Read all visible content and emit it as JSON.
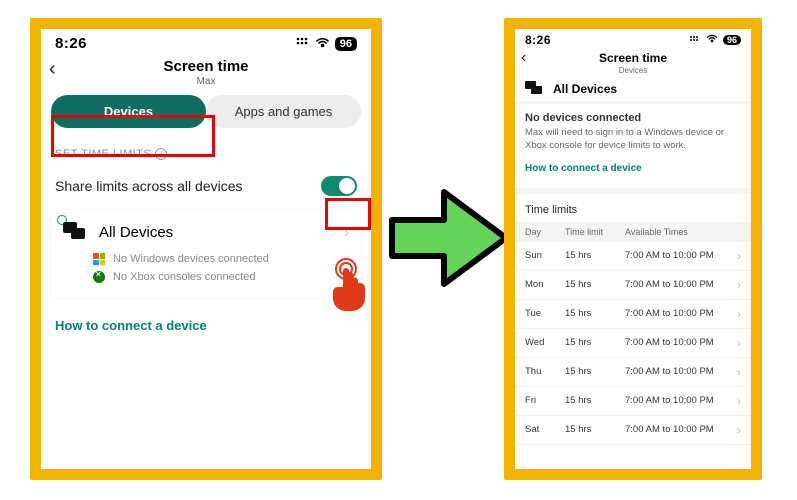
{
  "left": {
    "status": {
      "time": "8:26",
      "battery": "96"
    },
    "title": "Screen time",
    "subtitle": "Max",
    "tabs": {
      "devices": "Devices",
      "apps": "Apps and games"
    },
    "section_label": "SET TIME LIMITS",
    "share_label": "Share limits across all devices",
    "all_devices": "All Devices",
    "no_windows": "No Windows devices connected",
    "no_xbox": "No Xbox consoles connected",
    "how_to": "How to connect a device"
  },
  "right": {
    "status": {
      "time": "8:26",
      "battery": "96"
    },
    "title": "Screen time",
    "subtitle": "Devices",
    "all_devices": "All Devices",
    "no_devices_title": "No devices connected",
    "no_devices_note": "Max will need to sign in to a Windows device or Xbox console for device limits to work.",
    "how_to": "How to connect a device",
    "time_limits_label": "Time limits",
    "columns": {
      "day": "Day",
      "limit": "Time limit",
      "avail": "Available Times"
    },
    "rows": [
      {
        "day": "Sun",
        "limit": "15 hrs",
        "avail": "7:00 AM to 10:00 PM"
      },
      {
        "day": "Mon",
        "limit": "15 hrs",
        "avail": "7:00 AM to 10:00 PM"
      },
      {
        "day": "Tue",
        "limit": "15 hrs",
        "avail": "7:00 AM to 10:00 PM"
      },
      {
        "day": "Wed",
        "limit": "15 hrs",
        "avail": "7:00 AM to 10:00 PM"
      },
      {
        "day": "Thu",
        "limit": "15 hrs",
        "avail": "7:00 AM to 10:00 PM"
      },
      {
        "day": "Fri",
        "limit": "15 hrs",
        "avail": "7:00 AM to 10:00 PM"
      },
      {
        "day": "Sat",
        "limit": "15 hrs",
        "avail": "7:00 AM to 10:00 PM"
      }
    ]
  }
}
